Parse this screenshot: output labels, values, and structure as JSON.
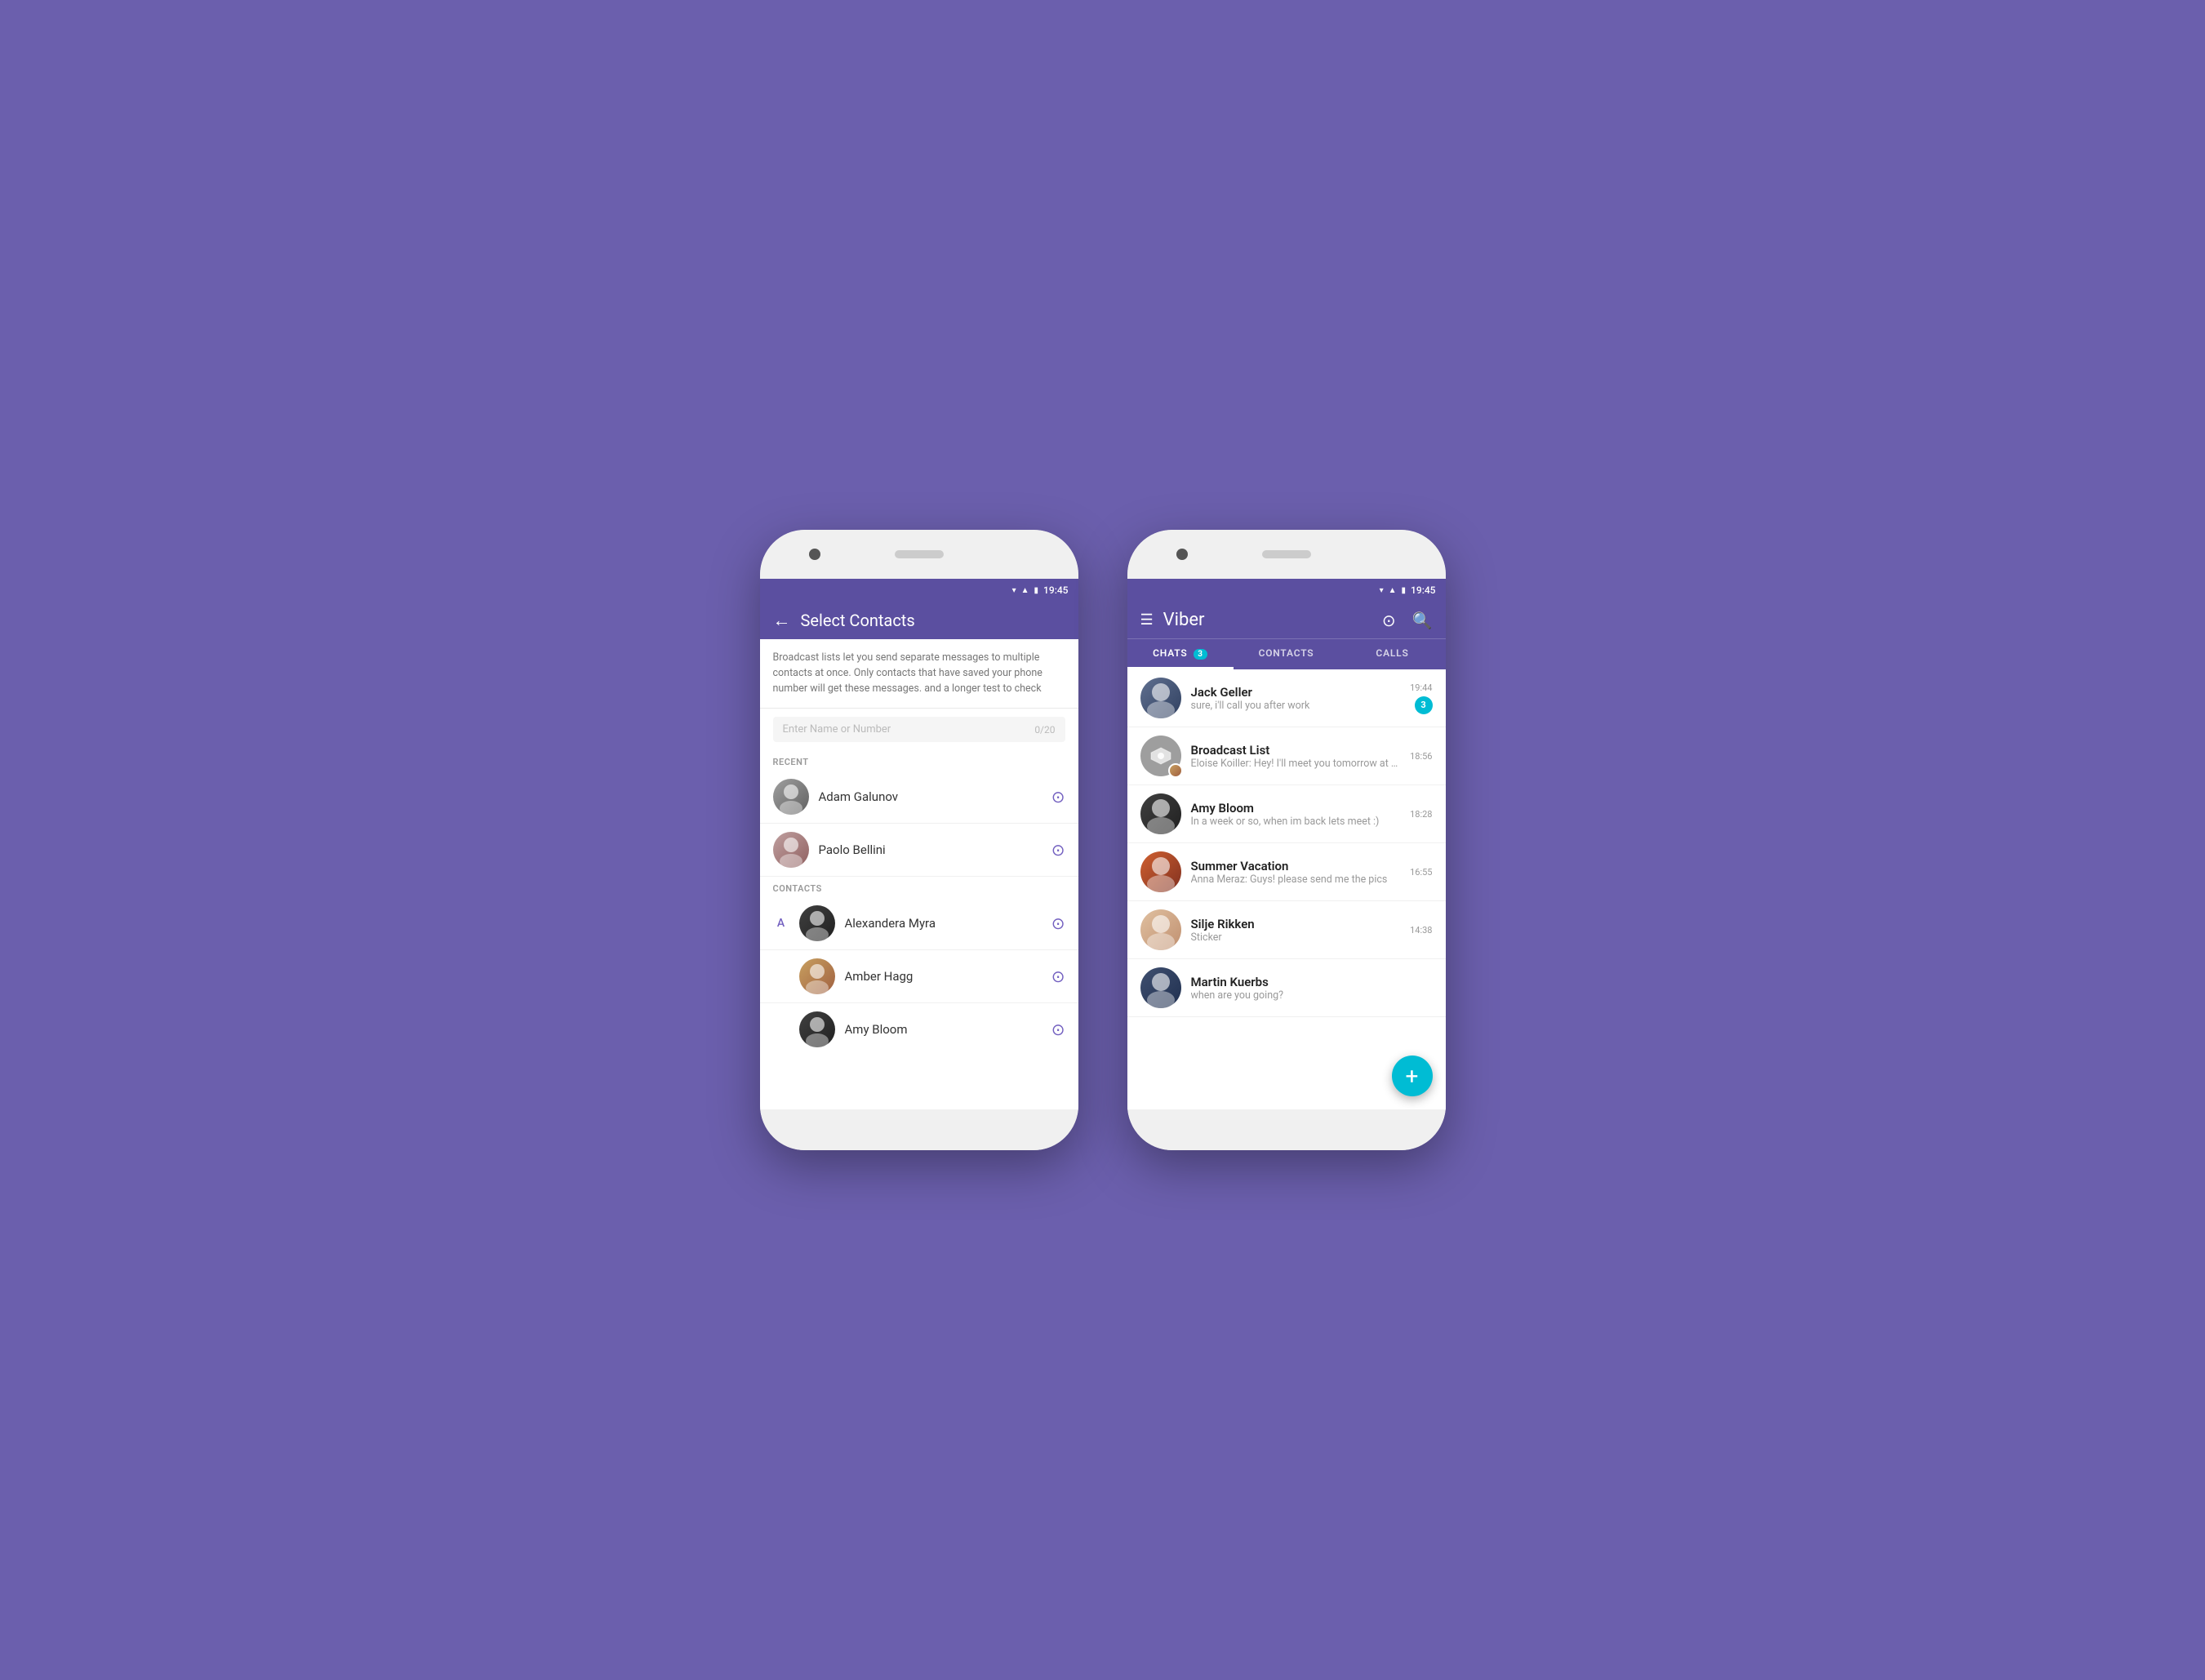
{
  "background_color": "#6b5fad",
  "phone1": {
    "status_bar": {
      "time": "19:45",
      "wifi_icon": "wifi",
      "signal_icon": "signal",
      "battery_icon": "battery"
    },
    "header": {
      "back_label": "←",
      "title": "Select Contacts"
    },
    "broadcast_info": "Broadcast lists let you send separate messages to multiple contacts at once. Only contacts that have saved your phone number will get these messages. and a longer test to check",
    "search": {
      "placeholder": "Enter Name or Number",
      "count": "0/20"
    },
    "sections": {
      "recent_label": "RECENT",
      "contacts_label": "CONTACTS"
    },
    "recent_contacts": [
      {
        "name": "Adam Galunov",
        "avatar_class": "av-adam"
      },
      {
        "name": "Paolo Bellini",
        "avatar_class": "av-paolo"
      }
    ],
    "contacts": [
      {
        "letter": "A",
        "name": "Alexandera Myra",
        "avatar_class": "av-alex"
      },
      {
        "letter": "",
        "name": "Amber Hagg",
        "avatar_class": "av-amber"
      },
      {
        "letter": "",
        "name": "Amy Bloom",
        "avatar_class": "av-amy-bloom"
      }
    ]
  },
  "phone2": {
    "status_bar": {
      "time": "19:45"
    },
    "header": {
      "menu_label": "☰",
      "title": "Viber",
      "search_icon": "search",
      "more_icon": "⊙"
    },
    "tabs": [
      {
        "label": "CHATS",
        "badge": "3",
        "active": true
      },
      {
        "label": "CONTACTS",
        "badge": "",
        "active": false
      },
      {
        "label": "CALLS",
        "badge": "",
        "active": false
      }
    ],
    "chats": [
      {
        "name": "Jack Geller",
        "preview": "sure, i'll call you after work",
        "time": "19:44",
        "unread": "3",
        "avatar_class": "av-jack"
      },
      {
        "name": "Broadcast List",
        "preview": "Eloise Koiller: Hey! I'll meet you tomorrow at R...",
        "time": "18:56",
        "unread": "",
        "is_broadcast": true
      },
      {
        "name": "Amy Bloom",
        "preview": "In a week or so, when im back lets meet :)",
        "time": "18:28",
        "unread": "",
        "avatar_class": "av-amy-bloom"
      },
      {
        "name": "Summer Vacation",
        "preview": "Anna Meraz: Guys! please send me the pics",
        "time": "16:55",
        "unread": "",
        "avatar_class": "av-summer"
      },
      {
        "name": "Silje Rikken",
        "preview": "Sticker",
        "time": "14:38",
        "unread": "",
        "avatar_class": "av-silje"
      },
      {
        "name": "Martin Kuerbs",
        "preview": "when are you going?",
        "time": "",
        "unread": "",
        "avatar_class": "av-martin"
      }
    ],
    "fab_label": "+"
  }
}
